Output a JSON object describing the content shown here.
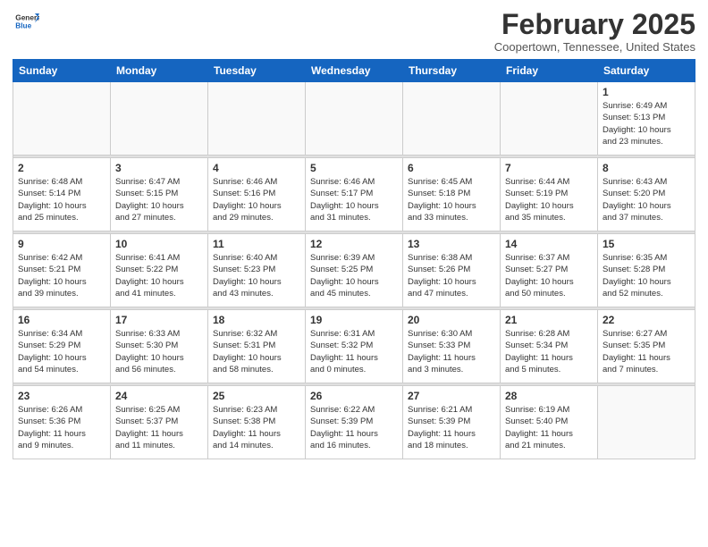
{
  "header": {
    "logo_line1": "General",
    "logo_line2": "Blue",
    "month": "February 2025",
    "location": "Coopertown, Tennessee, United States"
  },
  "weekdays": [
    "Sunday",
    "Monday",
    "Tuesday",
    "Wednesday",
    "Thursday",
    "Friday",
    "Saturday"
  ],
  "weeks": [
    [
      {
        "day": "",
        "info": ""
      },
      {
        "day": "",
        "info": ""
      },
      {
        "day": "",
        "info": ""
      },
      {
        "day": "",
        "info": ""
      },
      {
        "day": "",
        "info": ""
      },
      {
        "day": "",
        "info": ""
      },
      {
        "day": "1",
        "info": "Sunrise: 6:49 AM\nSunset: 5:13 PM\nDaylight: 10 hours\nand 23 minutes."
      }
    ],
    [
      {
        "day": "2",
        "info": "Sunrise: 6:48 AM\nSunset: 5:14 PM\nDaylight: 10 hours\nand 25 minutes."
      },
      {
        "day": "3",
        "info": "Sunrise: 6:47 AM\nSunset: 5:15 PM\nDaylight: 10 hours\nand 27 minutes."
      },
      {
        "day": "4",
        "info": "Sunrise: 6:46 AM\nSunset: 5:16 PM\nDaylight: 10 hours\nand 29 minutes."
      },
      {
        "day": "5",
        "info": "Sunrise: 6:46 AM\nSunset: 5:17 PM\nDaylight: 10 hours\nand 31 minutes."
      },
      {
        "day": "6",
        "info": "Sunrise: 6:45 AM\nSunset: 5:18 PM\nDaylight: 10 hours\nand 33 minutes."
      },
      {
        "day": "7",
        "info": "Sunrise: 6:44 AM\nSunset: 5:19 PM\nDaylight: 10 hours\nand 35 minutes."
      },
      {
        "day": "8",
        "info": "Sunrise: 6:43 AM\nSunset: 5:20 PM\nDaylight: 10 hours\nand 37 minutes."
      }
    ],
    [
      {
        "day": "9",
        "info": "Sunrise: 6:42 AM\nSunset: 5:21 PM\nDaylight: 10 hours\nand 39 minutes."
      },
      {
        "day": "10",
        "info": "Sunrise: 6:41 AM\nSunset: 5:22 PM\nDaylight: 10 hours\nand 41 minutes."
      },
      {
        "day": "11",
        "info": "Sunrise: 6:40 AM\nSunset: 5:23 PM\nDaylight: 10 hours\nand 43 minutes."
      },
      {
        "day": "12",
        "info": "Sunrise: 6:39 AM\nSunset: 5:25 PM\nDaylight: 10 hours\nand 45 minutes."
      },
      {
        "day": "13",
        "info": "Sunrise: 6:38 AM\nSunset: 5:26 PM\nDaylight: 10 hours\nand 47 minutes."
      },
      {
        "day": "14",
        "info": "Sunrise: 6:37 AM\nSunset: 5:27 PM\nDaylight: 10 hours\nand 50 minutes."
      },
      {
        "day": "15",
        "info": "Sunrise: 6:35 AM\nSunset: 5:28 PM\nDaylight: 10 hours\nand 52 minutes."
      }
    ],
    [
      {
        "day": "16",
        "info": "Sunrise: 6:34 AM\nSunset: 5:29 PM\nDaylight: 10 hours\nand 54 minutes."
      },
      {
        "day": "17",
        "info": "Sunrise: 6:33 AM\nSunset: 5:30 PM\nDaylight: 10 hours\nand 56 minutes."
      },
      {
        "day": "18",
        "info": "Sunrise: 6:32 AM\nSunset: 5:31 PM\nDaylight: 10 hours\nand 58 minutes."
      },
      {
        "day": "19",
        "info": "Sunrise: 6:31 AM\nSunset: 5:32 PM\nDaylight: 11 hours\nand 0 minutes."
      },
      {
        "day": "20",
        "info": "Sunrise: 6:30 AM\nSunset: 5:33 PM\nDaylight: 11 hours\nand 3 minutes."
      },
      {
        "day": "21",
        "info": "Sunrise: 6:28 AM\nSunset: 5:34 PM\nDaylight: 11 hours\nand 5 minutes."
      },
      {
        "day": "22",
        "info": "Sunrise: 6:27 AM\nSunset: 5:35 PM\nDaylight: 11 hours\nand 7 minutes."
      }
    ],
    [
      {
        "day": "23",
        "info": "Sunrise: 6:26 AM\nSunset: 5:36 PM\nDaylight: 11 hours\nand 9 minutes."
      },
      {
        "day": "24",
        "info": "Sunrise: 6:25 AM\nSunset: 5:37 PM\nDaylight: 11 hours\nand 11 minutes."
      },
      {
        "day": "25",
        "info": "Sunrise: 6:23 AM\nSunset: 5:38 PM\nDaylight: 11 hours\nand 14 minutes."
      },
      {
        "day": "26",
        "info": "Sunrise: 6:22 AM\nSunset: 5:39 PM\nDaylight: 11 hours\nand 16 minutes."
      },
      {
        "day": "27",
        "info": "Sunrise: 6:21 AM\nSunset: 5:39 PM\nDaylight: 11 hours\nand 18 minutes."
      },
      {
        "day": "28",
        "info": "Sunrise: 6:19 AM\nSunset: 5:40 PM\nDaylight: 11 hours\nand 21 minutes."
      },
      {
        "day": "",
        "info": ""
      }
    ]
  ]
}
